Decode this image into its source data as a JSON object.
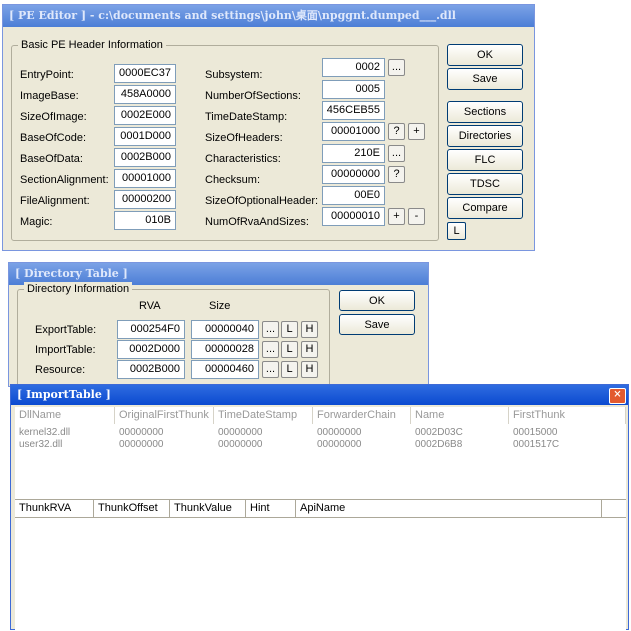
{
  "pe_editor": {
    "title": "[ PE Editor ] - c:\\documents and settings\\john\\桌面\\npggnt.dumped___.dll",
    "group_title": "Basic PE Header Information",
    "left_fields": [
      {
        "label": "EntryPoint:",
        "value": "0000EC37"
      },
      {
        "label": "ImageBase:",
        "value": "458A0000"
      },
      {
        "label": "SizeOfImage:",
        "value": "0002E000"
      },
      {
        "label": "BaseOfCode:",
        "value": "0001D000"
      },
      {
        "label": "BaseOfData:",
        "value": "0002B000"
      },
      {
        "label": "SectionAlignment:",
        "value": "00001000"
      },
      {
        "label": "FileAlignment:",
        "value": "00000200"
      },
      {
        "label": "Magic:",
        "value": "010B"
      }
    ],
    "right_fields": [
      {
        "label": "Subsystem:",
        "value": "0002"
      },
      {
        "label": "NumberOfSections:",
        "value": "0005"
      },
      {
        "label": "TimeDateStamp:",
        "value": "456CEB55"
      },
      {
        "label": "SizeOfHeaders:",
        "value": "00001000"
      },
      {
        "label": "Characteristics:",
        "value": "210E"
      },
      {
        "label": "Checksum:",
        "value": "00000000"
      },
      {
        "label": "SizeOfOptionalHeader:",
        "value": "00E0"
      },
      {
        "label": "NumOfRvaAndSizes:",
        "value": "00000010"
      }
    ],
    "small_buttons": {
      "dots": "...",
      "question": "?",
      "plus": "+",
      "minus": "-"
    },
    "buttons": {
      "ok": "OK",
      "save": "Save",
      "sections": "Sections",
      "directories": "Directories",
      "flc": "FLC",
      "tdsc": "TDSC",
      "compare": "Compare",
      "l": "L"
    }
  },
  "directory_table": {
    "title": "[ Directory Table ]",
    "group_title": "Directory Information",
    "col_rva": "RVA",
    "col_size": "Size",
    "rows": [
      {
        "label": "ExportTable:",
        "rva": "000254F0",
        "size": "00000040"
      },
      {
        "label": "ImportTable:",
        "rva": "0002D000",
        "size": "00000028"
      },
      {
        "label": "Resource:",
        "rva": "0002B000",
        "size": "00000460"
      }
    ],
    "row_buttons": {
      "dots": "...",
      "l": "L",
      "h": "H"
    },
    "buttons": {
      "ok": "OK",
      "save": "Save"
    }
  },
  "import_table": {
    "title": "[ ImportTable ]",
    "close": "×",
    "columns": [
      "DllName",
      "OriginalFirstThunk",
      "TimeDateStamp",
      "ForwarderChain",
      "Name",
      "FirstThunk"
    ],
    "rows": [
      [
        "kernel32.dll",
        "00000000",
        "00000000",
        "00000000",
        "0002D03C",
        "00015000"
      ],
      [
        "user32.dll",
        "00000000",
        "00000000",
        "00000000",
        "0002D6B8",
        "0001517C"
      ]
    ],
    "thunk_columns": [
      "ThunkRVA",
      "ThunkOffset",
      "ThunkValue",
      "Hint",
      "ApiName"
    ]
  }
}
